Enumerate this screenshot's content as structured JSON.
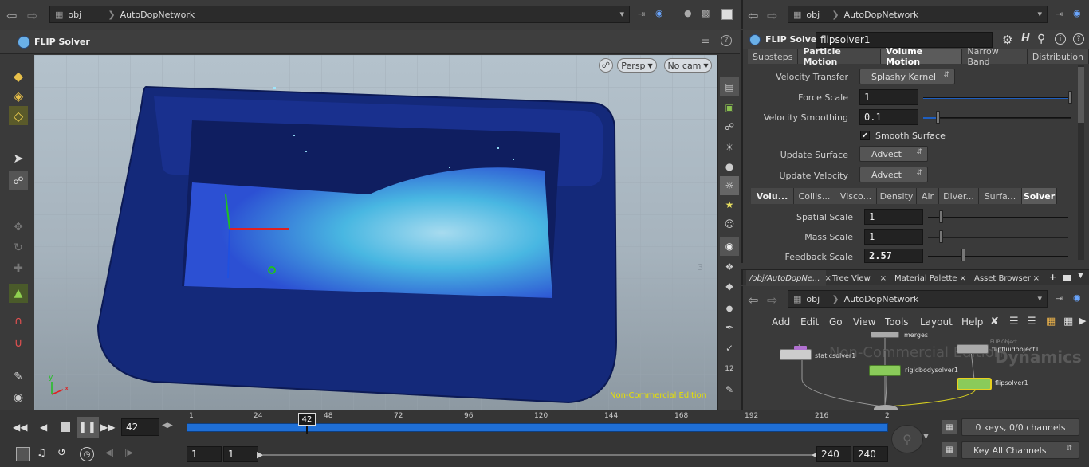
{
  "viewport_header": {
    "path_root": "obj",
    "path_network": "AutoDopNetwork",
    "pane_title": "FLIP Solver"
  },
  "viewport": {
    "persp_label": "Persp",
    "cam_label": "No cam",
    "watermark": "Non-Commercial Edition",
    "axis_x": "x",
    "axis_y": "y",
    "side_num": "3"
  },
  "params_header": {
    "path_root": "obj",
    "path_network": "AutoDopNetwork",
    "node_type": "FLIP Solver",
    "node_name": "flipsolver1"
  },
  "params": {
    "tabs": [
      "Substeps",
      "Particle Motion",
      "Volume Motion",
      "Narrow Band",
      "Distribution"
    ],
    "active_tab": "Volume Motion",
    "velocity_transfer_label": "Velocity Transfer",
    "velocity_transfer_value": "Splashy Kernel",
    "force_scale_label": "Force Scale",
    "force_scale_value": "1",
    "velocity_smoothing_label": "Velocity Smoothing",
    "velocity_smoothing_value": "0.1",
    "smooth_surface_label": "Smooth Surface",
    "update_surface_label": "Update Surface",
    "update_surface_value": "Advect",
    "update_velocity_label": "Update Velocity",
    "update_velocity_value": "Advect",
    "subtabs": [
      "Volu...",
      "Collis...",
      "Visco...",
      "Density",
      "Air",
      "Diver...",
      "Surfa...",
      "Solver"
    ],
    "active_subtab": "Solver",
    "spatial_scale_label": "Spatial Scale",
    "spatial_scale_value": "1",
    "mass_scale_label": "Mass Scale",
    "mass_scale_value": "1",
    "feedback_scale_label": "Feedback Scale",
    "feedback_scale_value": "2.57"
  },
  "network_tabs": [
    "/obj/AutoDopNe...",
    "Tree View",
    "Material Palette",
    "Asset Browser"
  ],
  "network_header": {
    "path_root": "obj",
    "path_network": "AutoDopNetwork"
  },
  "network_menu": [
    "Add",
    "Edit",
    "Go",
    "View",
    "Tools",
    "Layout",
    "Help"
  ],
  "network": {
    "watermark1": "Non-Commercial Edition",
    "watermark2": "Dynamics",
    "nodes": {
      "merge": "merges",
      "static": "staticsolver1",
      "rigid": "rigidbodysolver1",
      "flip_object_type": "FLIP Object",
      "flip_object": "flipfluidobject1",
      "flip_solver": "flipsolver1"
    }
  },
  "timeline": {
    "current_frame": "42",
    "ticks": [
      "1",
      "24",
      "48",
      "72",
      "96",
      "120",
      "144",
      "168",
      "192",
      "216",
      "2"
    ],
    "marker": "42",
    "range_start": "1",
    "range_start2": "1",
    "range_end": "240",
    "range_end2": "240",
    "keys_status": "0 keys, 0/0 channels",
    "key_all": "Key All Channels"
  },
  "colors": {
    "accent": "#e8b04a",
    "timeline_blue": "#1f6fd6",
    "tank_blue": "#142a7a",
    "particle": "#4fc8f0"
  }
}
